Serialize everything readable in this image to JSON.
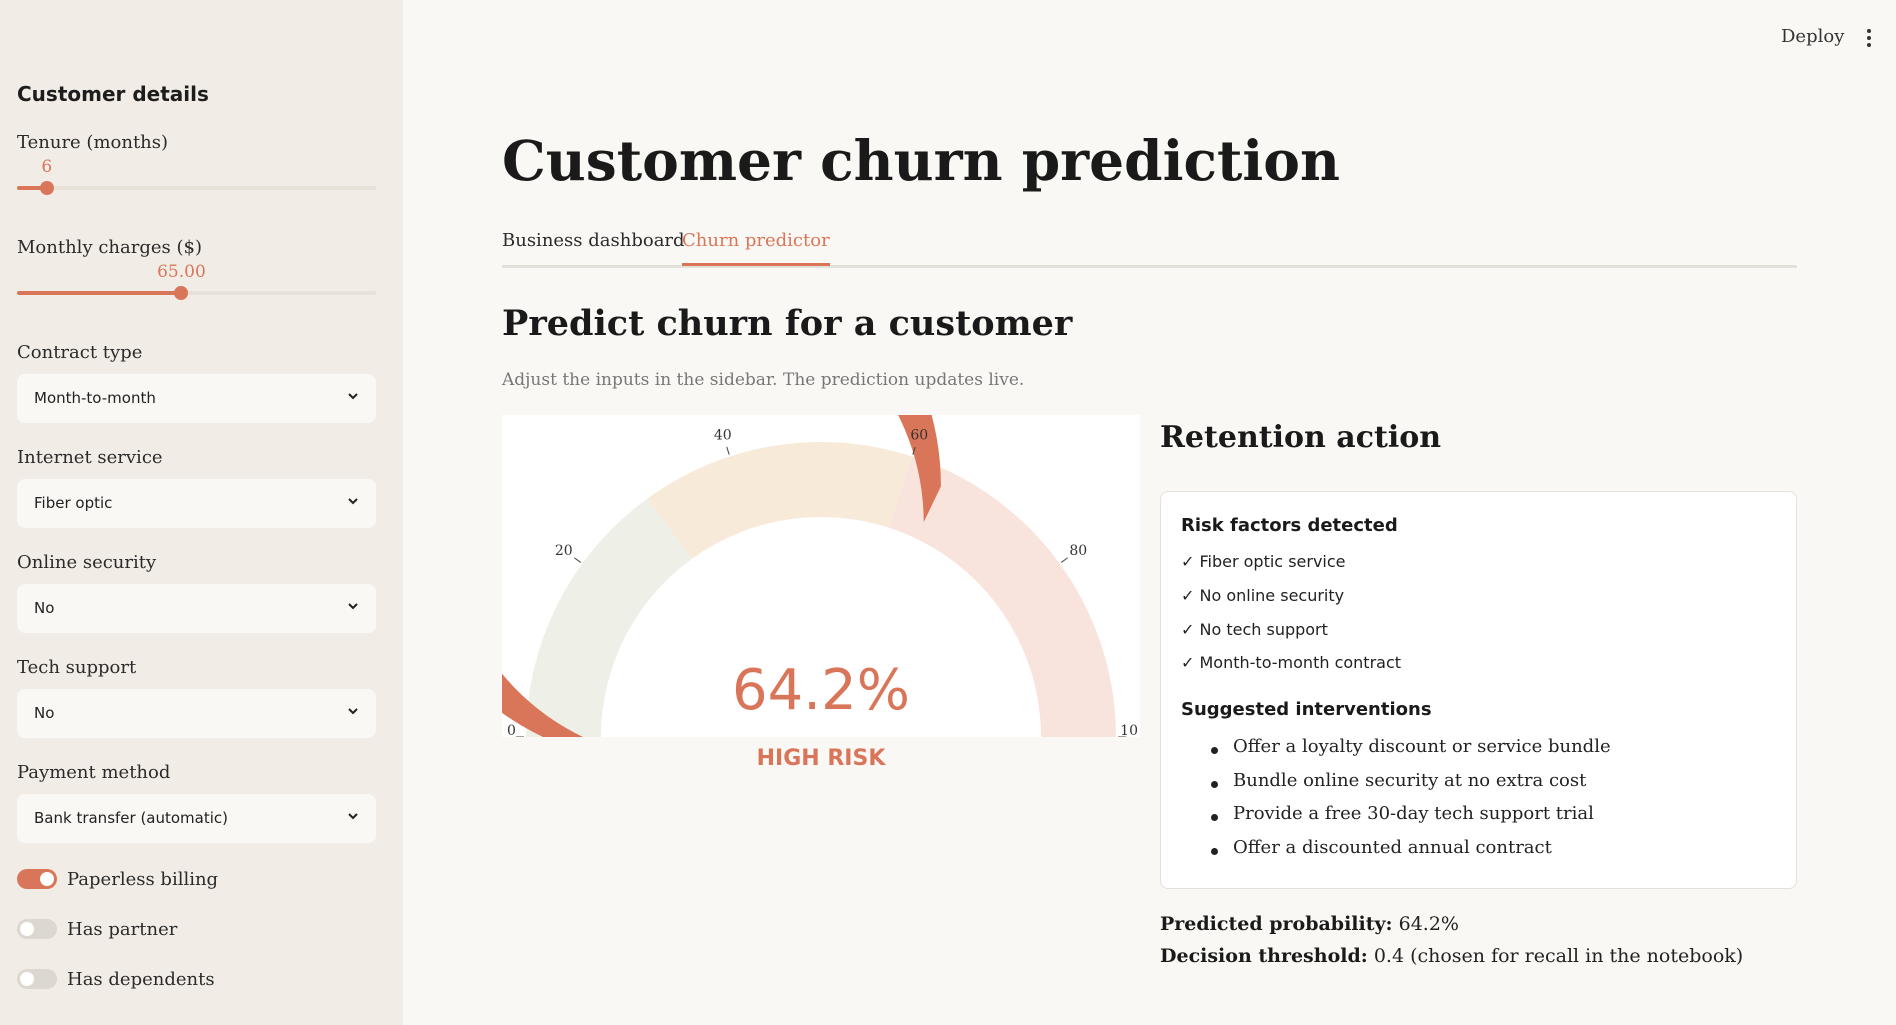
{
  "header": {
    "deploy_label": "Deploy",
    "menu_icon": "vertical-dots-icon"
  },
  "sidebar": {
    "title": "Customer details",
    "tenure": {
      "label": "Tenure (months)",
      "value": "6",
      "fraction": 0.083
    },
    "monthly_charges": {
      "label": "Monthly charges ($)",
      "value": "65.00",
      "fraction": 0.458
    },
    "contract": {
      "label": "Contract type",
      "value": "Month-to-month"
    },
    "internet": {
      "label": "Internet service",
      "value": "Fiber optic"
    },
    "security": {
      "label": "Online security",
      "value": "No"
    },
    "tech": {
      "label": "Tech support",
      "value": "No"
    },
    "payment": {
      "label": "Payment method",
      "value": "Bank transfer (automatic)"
    },
    "toggles": [
      {
        "label": "Paperless billing",
        "on": true
      },
      {
        "label": "Has partner",
        "on": false
      },
      {
        "label": "Has dependents",
        "on": false
      }
    ]
  },
  "main": {
    "title": "Customer churn prediction",
    "tabs": [
      {
        "label": "Business dashboard"
      },
      {
        "label": "Churn predictor"
      }
    ],
    "active_tab": 1,
    "section_title": "Predict churn for a customer",
    "caption": "Adjust the inputs in the sidebar. The prediction updates live."
  },
  "gauge": {
    "value": 64.2,
    "display": "64.2%",
    "risk_label": "HIGH RISK",
    "ticks": [
      "0",
      "20",
      "40",
      "60",
      "80",
      "10"
    ],
    "colors": {
      "bar": "#d9765a",
      "low": "#eef0e8",
      "mid": "#f7ead9",
      "high": "#f9e4dd"
    }
  },
  "retention": {
    "title": "Retention action",
    "factors_title": "Risk factors detected",
    "factors": [
      "✓ Fiber optic service",
      "✓ No online security",
      "✓ No tech support",
      "✓ Month-to-month contract"
    ],
    "interventions_title": "Suggested interventions",
    "interventions": [
      "Offer a loyalty discount or service bundle",
      "Bundle online security at no extra cost",
      "Provide a free 30-day tech support trial",
      "Offer a discounted annual contract"
    ]
  },
  "stats": {
    "probability_label": "Predicted probability:",
    "probability_value": "64.2%",
    "threshold_label": "Decision threshold:",
    "threshold_value": "0.4 (chosen for recall in the notebook)"
  }
}
